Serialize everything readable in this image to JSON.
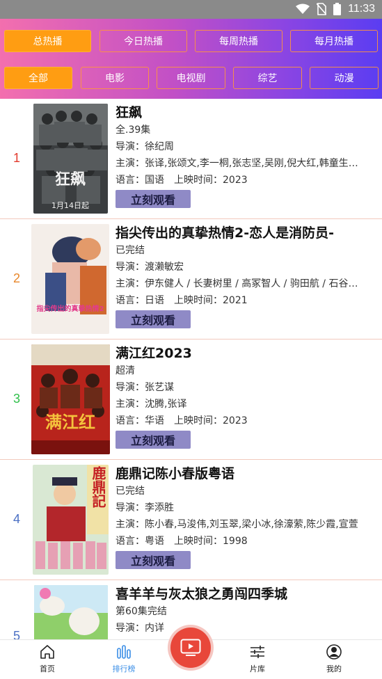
{
  "status_bar": {
    "time": "11:33"
  },
  "filters": {
    "period_tabs": [
      "总热播",
      "今日热播",
      "每周热播",
      "每月热播"
    ],
    "category_tabs": [
      "全部",
      "电影",
      "电视剧",
      "综艺",
      "动漫"
    ]
  },
  "colors": {
    "accent_orange": "#ff9d12",
    "button_purple": "#8f8ac6",
    "center_red": "#e8473a",
    "active_blue": "#3a8ee6"
  },
  "labels": {
    "director": "导演：",
    "cast": "主演：",
    "language": "语言：",
    "release": "上映时间：",
    "watch": "立刻观看"
  },
  "items": [
    {
      "rank": "1",
      "rank_color": "#e23b2e",
      "title": "狂飙",
      "status": "全.39集",
      "director": "徐纪周",
      "cast": "张译,张颂文,李一桐,张志坚,吴刚,倪大红,韩童生,高叶",
      "language": "国语",
      "year": "2023"
    },
    {
      "rank": "2",
      "rank_color": "#e8872a",
      "title": "指尖传出的真挚热情2-恋人是消防员-",
      "status": "已完结",
      "director": "渡濑敏宏",
      "cast": "伊东健人 / 长妻树里 / 高冢智人 / 驹田航 / 石谷春贵",
      "language": "日语",
      "year": "2021"
    },
    {
      "rank": "3",
      "rank_color": "#2fbf4a",
      "title": "满江红2023",
      "status": "超清",
      "director": "张艺谋",
      "cast": "沈腾,张译",
      "language": "华语",
      "year": "2023"
    },
    {
      "rank": "4",
      "rank_color": "#4a6fc4",
      "title": "鹿鼎记陈小春版粤语",
      "status": "已完结",
      "director": "李添胜",
      "cast": "陈小春,马浚伟,刘玉翠,梁小冰,徐濠萦,陈少霞,宣萱",
      "language": "粤语",
      "year": "1998"
    },
    {
      "rank": "5",
      "rank_color": "#4a6fc4",
      "title": "喜羊羊与灰太狼之勇闯四季城",
      "status": "第60集完结",
      "director": "内详",
      "cast": "",
      "language": "",
      "year": ""
    }
  ],
  "poster_text": {
    "p1_title": "狂飙",
    "p1_date": "1月14日起",
    "p2_title": "指尖传出的真挚热情2",
    "p3_title": "满江红",
    "p4_title": "鹿鼎記"
  },
  "bottom_nav": {
    "home": "首页",
    "rank": "排行榜",
    "library": "片库",
    "mine": "我的"
  }
}
